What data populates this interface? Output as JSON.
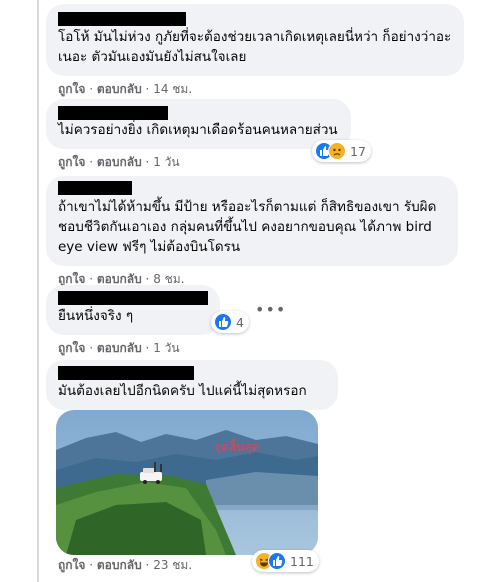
{
  "colors": {
    "bubble": "#f0f2f5",
    "meta": "#65676b",
    "like": "#1877f2",
    "emoji": "#f7b125"
  },
  "comments": [
    {
      "text": "โอโห้ มันไม่ห่วง กูภัยที่จะต้องช่วยเวลาเกิดเหตุเลยนี่หว่า ก็อย่างว่าอะเนอะ ตัวมันเองมันยังไม่สนใจเลย",
      "like": "ถูกใจ",
      "reply": "ตอบกลับ",
      "time": "14 ชม."
    },
    {
      "text": "ไม่ควรอย่างยิ่ง เกิดเหตุมาเดือดร้อนคนหลายส่วน",
      "like": "ถูกใจ",
      "reply": "ตอบกลับ",
      "time": "1 วัน",
      "reactions": {
        "icons": [
          "like-icon",
          "sad-icon"
        ],
        "count": "17"
      }
    },
    {
      "text": "ถ้าเขาไม่ได้ห้ามขึ้น มีป้าย หรืออะไรก็ตามแต่ ก็สิทธิของเขา รับผิดชอบชีวิตกันเอาเอง กลุ่มคนที่ขึ้นไป คงอยากขอบคุณ ได้ภาพ bird eye view ฟรีๆ ไม่ต้องบินโดรน",
      "like": "ถูกใจ",
      "reply": "ตอบกลับ",
      "time": "8 ชม."
    },
    {
      "text": "ยืนหนึ่งจริง ๆ",
      "like": "ถูกใจ",
      "reply": "ตอบกลับ",
      "time": "1 วัน",
      "reactions": {
        "icons": [
          "like-icon"
        ],
        "count": "4"
      },
      "more": "•••"
    },
    {
      "text": "มันต้องเลยไปอีกนิดครับ ไปแค่นี้ไม่สุดหรอก",
      "like": "ถูกใจ",
      "reply": "ตอบกลับ",
      "time": "23 ชม.",
      "reactions": {
        "icons": [
          "haha-icon",
          "like-icon"
        ],
        "count": "111"
      },
      "photo_caption": "จุดสิ้นสุด"
    }
  ]
}
